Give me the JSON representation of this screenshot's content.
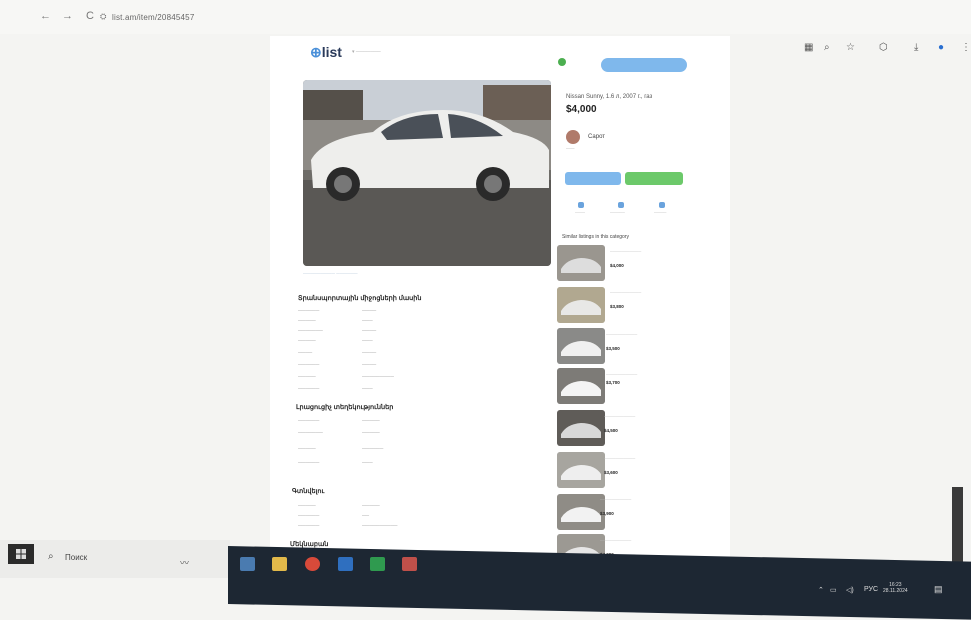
{
  "browser": {
    "url": "list.am/item/20845457",
    "back_icon": "←",
    "forward_icon": "→",
    "reload_icon": "C"
  },
  "site": {
    "logo_text": "list",
    "logo_mark": "⊕"
  },
  "listing": {
    "title": "Nissan Sunny, 1.6 л, 2007 г., газ",
    "price": "$4,000",
    "seller_name": "Сарот",
    "section_specs": "Տրանսպորտային միջոցների մասին",
    "section_extra": "Լրացուցիչ տեղեկություններ",
    "section_location": "Գտնվելու",
    "section_photos": "Մեկնաբան",
    "similar_heading": "Similar listings in this category",
    "similar_prices": [
      "$4,000",
      "$3,800",
      "$3,500",
      "$3,700",
      "$4,500",
      "$3,600",
      "$3,900",
      "$4,200"
    ]
  },
  "taskbar": {
    "search_label": "Поиск",
    "lang": "РУС",
    "time": "16:23",
    "date": "28.11.2024"
  },
  "colors": {
    "accent_blue": "#7fb8ec",
    "accent_green": "#6cc96a",
    "taskbar": "#1d2733"
  }
}
